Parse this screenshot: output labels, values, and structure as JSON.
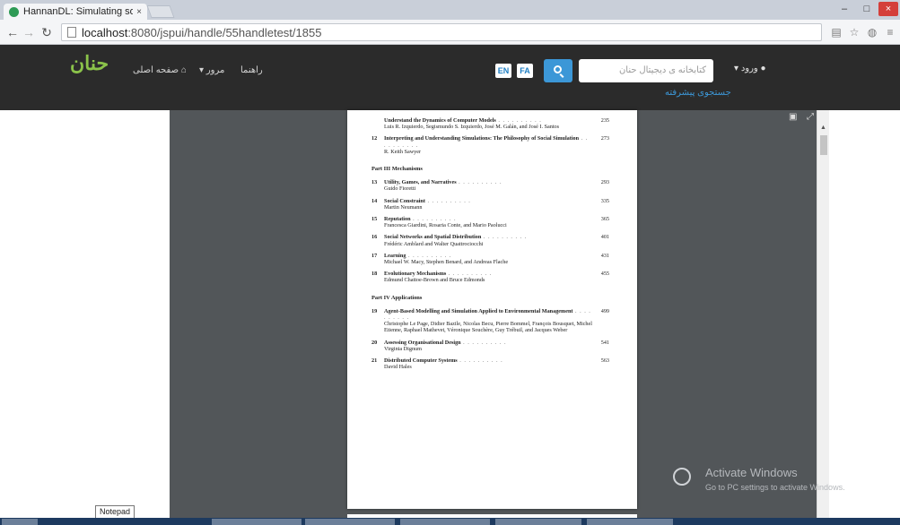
{
  "browser": {
    "tab_title": "HannanDL: Simulating soc",
    "tab_close": "×",
    "url_host": "localhost",
    "url_path": ":8080/jspui/handle/55handletest/1855",
    "window_controls": {
      "minimize": "–",
      "maximize": "□",
      "close": "×"
    }
  },
  "site": {
    "logo": "حنان",
    "nav": {
      "home": "صفحه اصلی",
      "browse": "مرور",
      "help": "راهنما"
    },
    "lang_en": "EN",
    "lang_fa": "FA",
    "search_placeholder": "کتابخانه ی دیجیتال حنان",
    "login": "ورود",
    "advanced_search": "جستجوی پیشرفته"
  },
  "document": {
    "entries_top": [
      {
        "num": "",
        "title": "Understand the Dynamics of Computer Models",
        "page": "235",
        "authors": "Luis R. Izquierdo, Segismundo S. Izquierdo, José M. Galán, and José I. Santos"
      },
      {
        "num": "12",
        "title": "Interpreting and Understanding Simulations: The Philosophy of Social Simulation",
        "page": "273",
        "authors": "R. Keith Sawyer"
      }
    ],
    "parts": [
      {
        "label": "Part III   Mechanisms",
        "entries": [
          {
            "num": "13",
            "title": "Utility, Games, and Narratives",
            "page": "293",
            "authors": "Guido Fioretti"
          },
          {
            "num": "14",
            "title": "Social Constraint",
            "page": "335",
            "authors": "Martin Neumann"
          },
          {
            "num": "15",
            "title": "Reputation",
            "page": "365",
            "authors": "Francesca Giardini, Rosaria Conte, and Mario Paolucci"
          },
          {
            "num": "16",
            "title": "Social Networks and Spatial Distribution",
            "page": "401",
            "authors": "Frédéric Amblard and Walter Quattrociocchi"
          },
          {
            "num": "17",
            "title": "Learning",
            "page": "431",
            "authors": "Michael W. Macy, Stephen Benard, and Andreas Flache"
          },
          {
            "num": "18",
            "title": "Evolutionary Mechanisms",
            "page": "455",
            "authors": "Edmund Chattoe-Brown and Bruce Edmonds"
          }
        ]
      },
      {
        "label": "Part IV   Applications",
        "entries": [
          {
            "num": "19",
            "title": "Agent-Based Modelling and Simulation Applied to Environmental Management",
            "page": "499",
            "authors": "Christophe Le Page, Didier Bazile, Nicolas Becu, Pierre Bommel, François Bousquet, Michel Etienne, Raphael Mathevet, Véronique Souchère, Guy Trébuil, and Jacques Weber"
          },
          {
            "num": "20",
            "title": "Assessing Organisational Design",
            "page": "541",
            "authors": "Virginia Dignum"
          },
          {
            "num": "21",
            "title": "Distributed Computer Systems",
            "page": "563",
            "authors": "David Hales"
          }
        ]
      }
    ]
  },
  "overlay": {
    "tooltip": "Notepad",
    "activate_title": "Activate Windows",
    "activate_sub": "Go to PC settings to activate Windows."
  }
}
